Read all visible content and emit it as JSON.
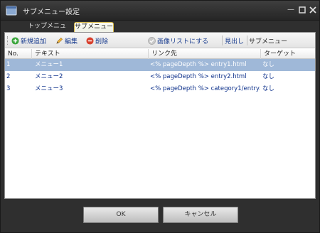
{
  "window": {
    "title": "サブメニュー設定"
  },
  "tabs": [
    {
      "label": "トップメニュー"
    },
    {
      "label": "サブメニュー"
    }
  ],
  "toolbar": {
    "add_label": "新規追加",
    "edit_label": "編集",
    "delete_label": "削除",
    "image_list_label": "画像リストにする",
    "heading_label": "見出し",
    "submenu_label": "サブメニュー"
  },
  "table": {
    "columns": [
      "No.",
      "テキスト",
      "リンク先",
      "ターゲット"
    ],
    "rows": [
      {
        "no": "1",
        "text": "メニュー1",
        "link": "<% pageDepth %> entry1.html",
        "target": "なし",
        "selected": true
      },
      {
        "no": "2",
        "text": "メニュー2",
        "link": "<% pageDepth %> entry2.html",
        "target": "なし",
        "selected": false
      },
      {
        "no": "3",
        "text": "メニュー3",
        "link": "<% pageDepth %> category1/entry...",
        "target": "なし",
        "selected": false
      }
    ]
  },
  "buttons": {
    "ok_label": "OK",
    "cancel_label": "キャンセル"
  },
  "colors": {
    "selection": "#9fb8d8",
    "link_text": "#0b2f8a",
    "tab_border": "#d7b848"
  }
}
